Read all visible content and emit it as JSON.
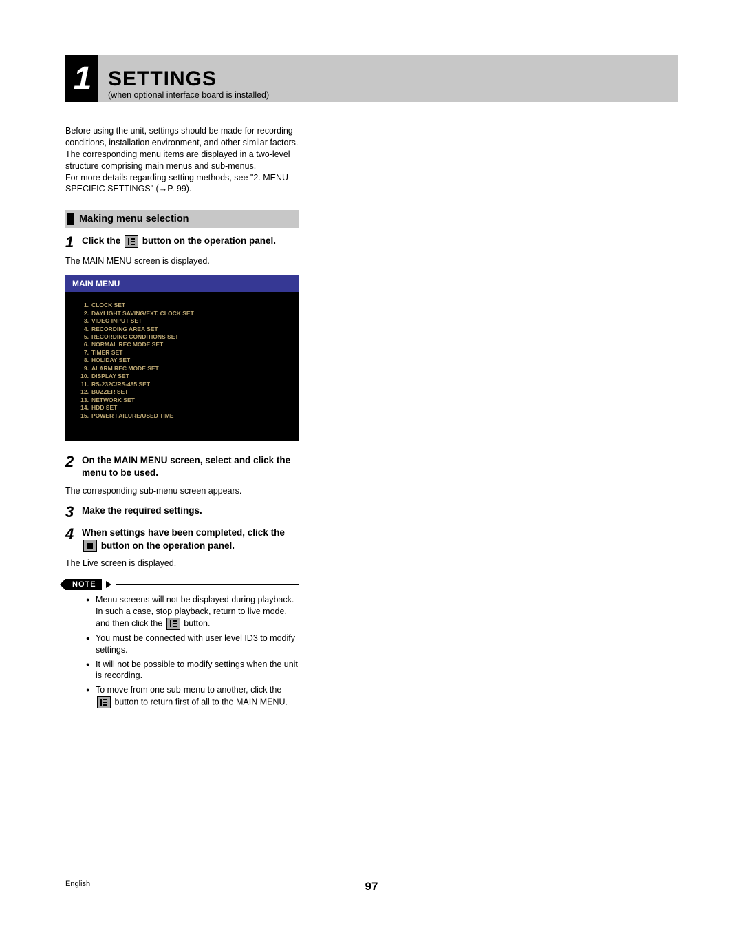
{
  "chapter": {
    "number": "1",
    "title": "SETTINGS",
    "subtitle": "(when optional interface board is installed)"
  },
  "intro": {
    "p1": "Before using the unit, settings should be made for recording conditions, installation environment, and other similar factors. The corresponding menu items are displayed in a two-level structure comprising main menus and sub-menus.",
    "p2": "For more details regarding setting methods, see \"2. MENU-SPECIFIC SETTINGS\" (→P. 99)."
  },
  "section_title": "Making menu selection",
  "steps": {
    "s1": {
      "num": "1",
      "pre": "Click the ",
      "post": " button on the operation panel.",
      "body": "The MAIN MENU screen is displayed."
    },
    "s2": {
      "num": "2",
      "text": "On the MAIN MENU screen, select and click the menu to be used.",
      "body": "The corresponding sub-menu screen appears."
    },
    "s3": {
      "num": "3",
      "text": "Make the required settings."
    },
    "s4": {
      "num": "4",
      "pre": "When settings have been completed, click the ",
      "post": " button on the operation panel.",
      "body": "The Live screen is displayed."
    }
  },
  "main_menu": {
    "title": "MAIN MENU",
    "items": [
      {
        "n": "1.",
        "t": "CLOCK SET"
      },
      {
        "n": "2.",
        "t": "DAYLIGHT SAVING/EXT. CLOCK SET"
      },
      {
        "n": "3.",
        "t": "VIDEO INPUT SET"
      },
      {
        "n": "4.",
        "t": "RECORDING AREA SET"
      },
      {
        "n": "5.",
        "t": "RECORDING CONDITIONS SET"
      },
      {
        "n": "6.",
        "t": "NORMAL REC MODE SET"
      },
      {
        "n": "7.",
        "t": "TIMER SET"
      },
      {
        "n": "8.",
        "t": "HOLIDAY SET"
      },
      {
        "n": "9.",
        "t": "ALARM REC MODE SET"
      },
      {
        "n": "10.",
        "t": "DISPLAY SET"
      },
      {
        "n": "11.",
        "t": "RS-232C/RS-485 SET"
      },
      {
        "n": "12.",
        "t": "BUZZER SET"
      },
      {
        "n": "13.",
        "t": "NETWORK SET"
      },
      {
        "n": "14.",
        "t": "HDD SET"
      },
      {
        "n": "15.",
        "t": "POWER FAILURE/USED TIME"
      }
    ]
  },
  "note_label": "NOTE",
  "notes": {
    "n1_pre": "Menu screens will not be displayed during playback. In such a case, stop playback, return to live mode, and then click the ",
    "n1_post": " button.",
    "n2": "You must be connected with user level ID3 to modify settings.",
    "n3": "It will not be possible to modify settings when the unit is recording.",
    "n4_pre": "To move from one sub-menu to another, click the ",
    "n4_post": " button to return first of all to the MAIN MENU."
  },
  "footer": {
    "lang": "English",
    "page": "97"
  }
}
